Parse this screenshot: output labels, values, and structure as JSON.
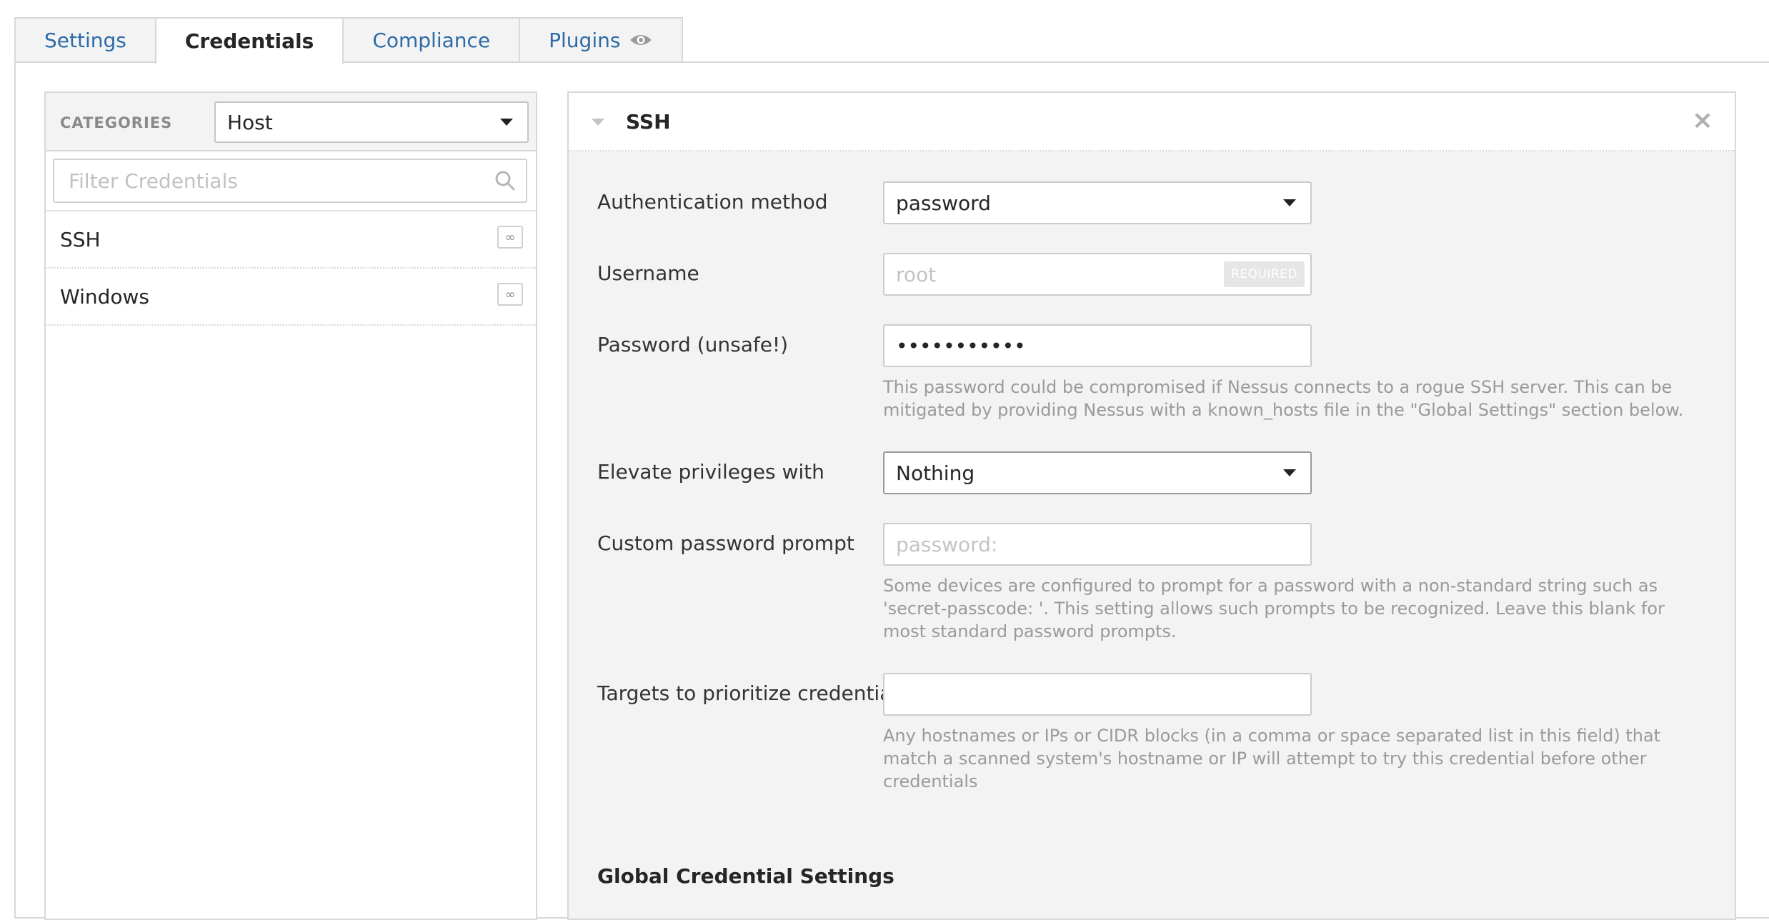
{
  "tabs": [
    {
      "label": "Settings",
      "active": false
    },
    {
      "label": "Credentials",
      "active": true
    },
    {
      "label": "Compliance",
      "active": false
    },
    {
      "label": "Plugins",
      "active": false,
      "icon": "eye-icon"
    }
  ],
  "sidebar": {
    "categories_label": "CATEGORIES",
    "category_selected": "Host",
    "filter_placeholder": "Filter Credentials",
    "items": [
      {
        "label": "SSH",
        "icon": "infinity-icon"
      },
      {
        "label": "Windows",
        "icon": "infinity-icon"
      }
    ]
  },
  "panel": {
    "title": "SSH",
    "fields": {
      "auth_method": {
        "label": "Authentication method",
        "value": "password"
      },
      "username": {
        "label": "Username",
        "placeholder": "root",
        "badge": "REQUIRED"
      },
      "password": {
        "label": "Password (unsafe!)",
        "value": "•••••••••••",
        "help": "This password could be compromised if Nessus connects to a rogue SSH server. This can be mitigated by providing Nessus with a known_hosts file in the \"Global Settings\" section below."
      },
      "elevate": {
        "label": "Elevate privileges with",
        "value": "Nothing"
      },
      "custom_prompt": {
        "label": "Custom password prompt",
        "placeholder": "password:",
        "help": "Some devices are configured to prompt for a password with a non-standard string such as 'secret-passcode: '. This setting allows such prompts to be recognized. Leave this blank for most standard password prompts."
      },
      "targets": {
        "label": "Targets to prioritize credentials",
        "value": "",
        "help": "Any hostnames or IPs or CIDR blocks (in a comma or space separated list in this field) that match a scanned system's hostname or IP will attempt to try this credential before other credentials"
      }
    },
    "global_settings_title": "Global Credential Settings"
  },
  "colors": {
    "link": "#2d6ba8",
    "border": "#d8d8d8",
    "panel_bg": "#f3f3f3"
  }
}
